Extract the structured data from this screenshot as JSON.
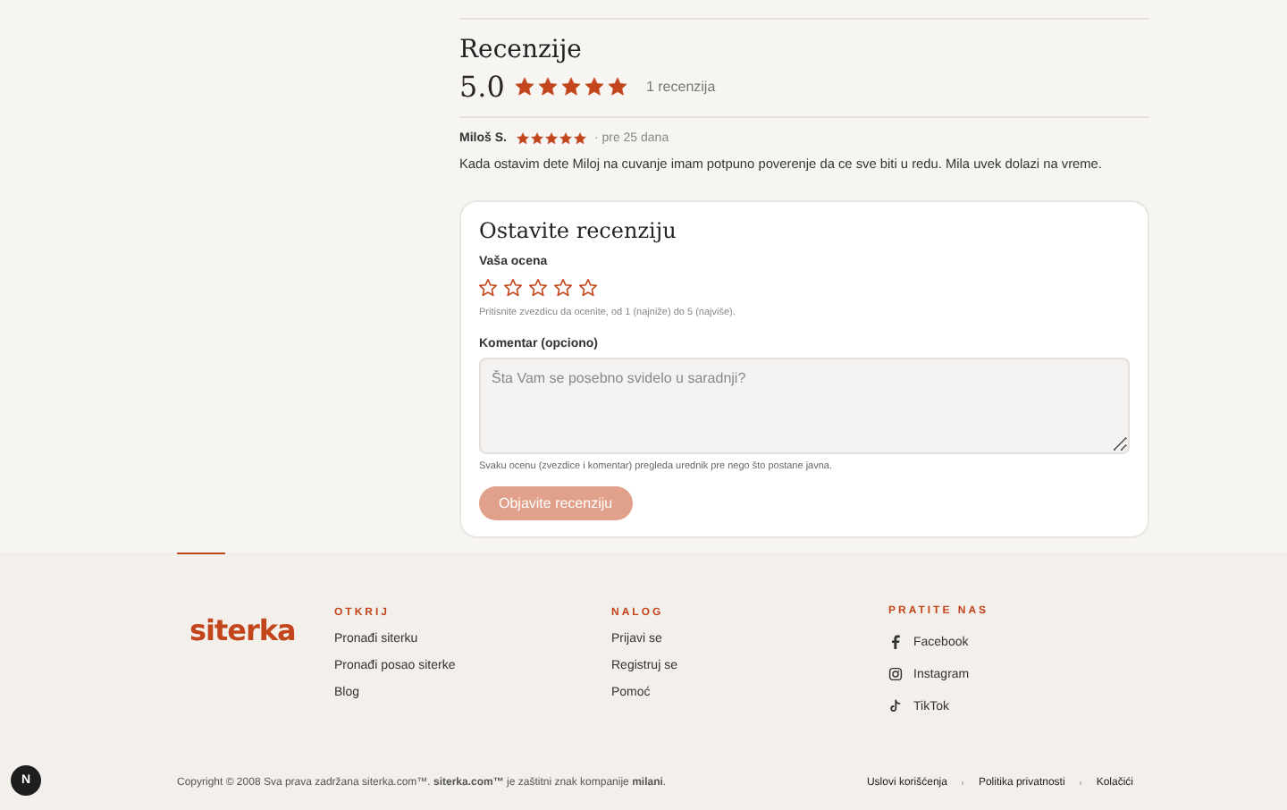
{
  "reviews": {
    "title": "Recenzije",
    "average": "5.0",
    "stars": 5,
    "count": "1 recenzija",
    "items": [
      {
        "author": "Miloš S.",
        "stars": 5,
        "date": "· pre 25 dana",
        "text": "Kada ostavim dete Miloj na cuvanje imam potpuno poverenje da ce sve biti u redu. Mila uvek dolazi na vreme."
      }
    ]
  },
  "review_form": {
    "title": "Ostavite recenziju",
    "rating_label": "Vaša ocena",
    "stars": 0,
    "rating_hint": "Pritisnite zvezdicu da ocenite, od 1 (najniže) do 5 (najviše).",
    "comment_label": "Komentar (opciono)",
    "comment_placeholder": "Šta Vam se posebno svidelo u saradnji?",
    "moderation_note": "Svaku ocenu (zvezdice i komentar) pregleda urednik pre nego što postane javna.",
    "submit": {
      "label": "Objavite recenziju",
      "disabled": true
    }
  },
  "footer": {
    "logo": "siterka",
    "columns": [
      {
        "heading": "OTKRIJ",
        "links": [
          {
            "label": "Pronađi siterku"
          },
          {
            "label": "Pronađi posao siterke"
          },
          {
            "label": "Blog"
          }
        ]
      },
      {
        "heading": "NALOG",
        "links": [
          {
            "label": "Prijavi se"
          },
          {
            "label": "Registruj se"
          },
          {
            "label": "Pomoć"
          }
        ]
      },
      {
        "heading": "PRATITE NAS",
        "links": [
          {
            "label": "Facebook",
            "kind": "facebook"
          },
          {
            "label": "Instagram",
            "kind": "instagram"
          },
          {
            "label": "TikTok",
            "kind": "tiktok"
          }
        ]
      }
    ],
    "copyright": "Copyright © 2008 Sva prava zadržana siterka.com™. **siterka.com™** je zaštitni znak kompanije **milani**.",
    "legal_links": [
      "Uslovi korišćenja",
      "Politika privatnosti",
      "Kolačići"
    ]
  },
  "dev_badge": "N"
}
